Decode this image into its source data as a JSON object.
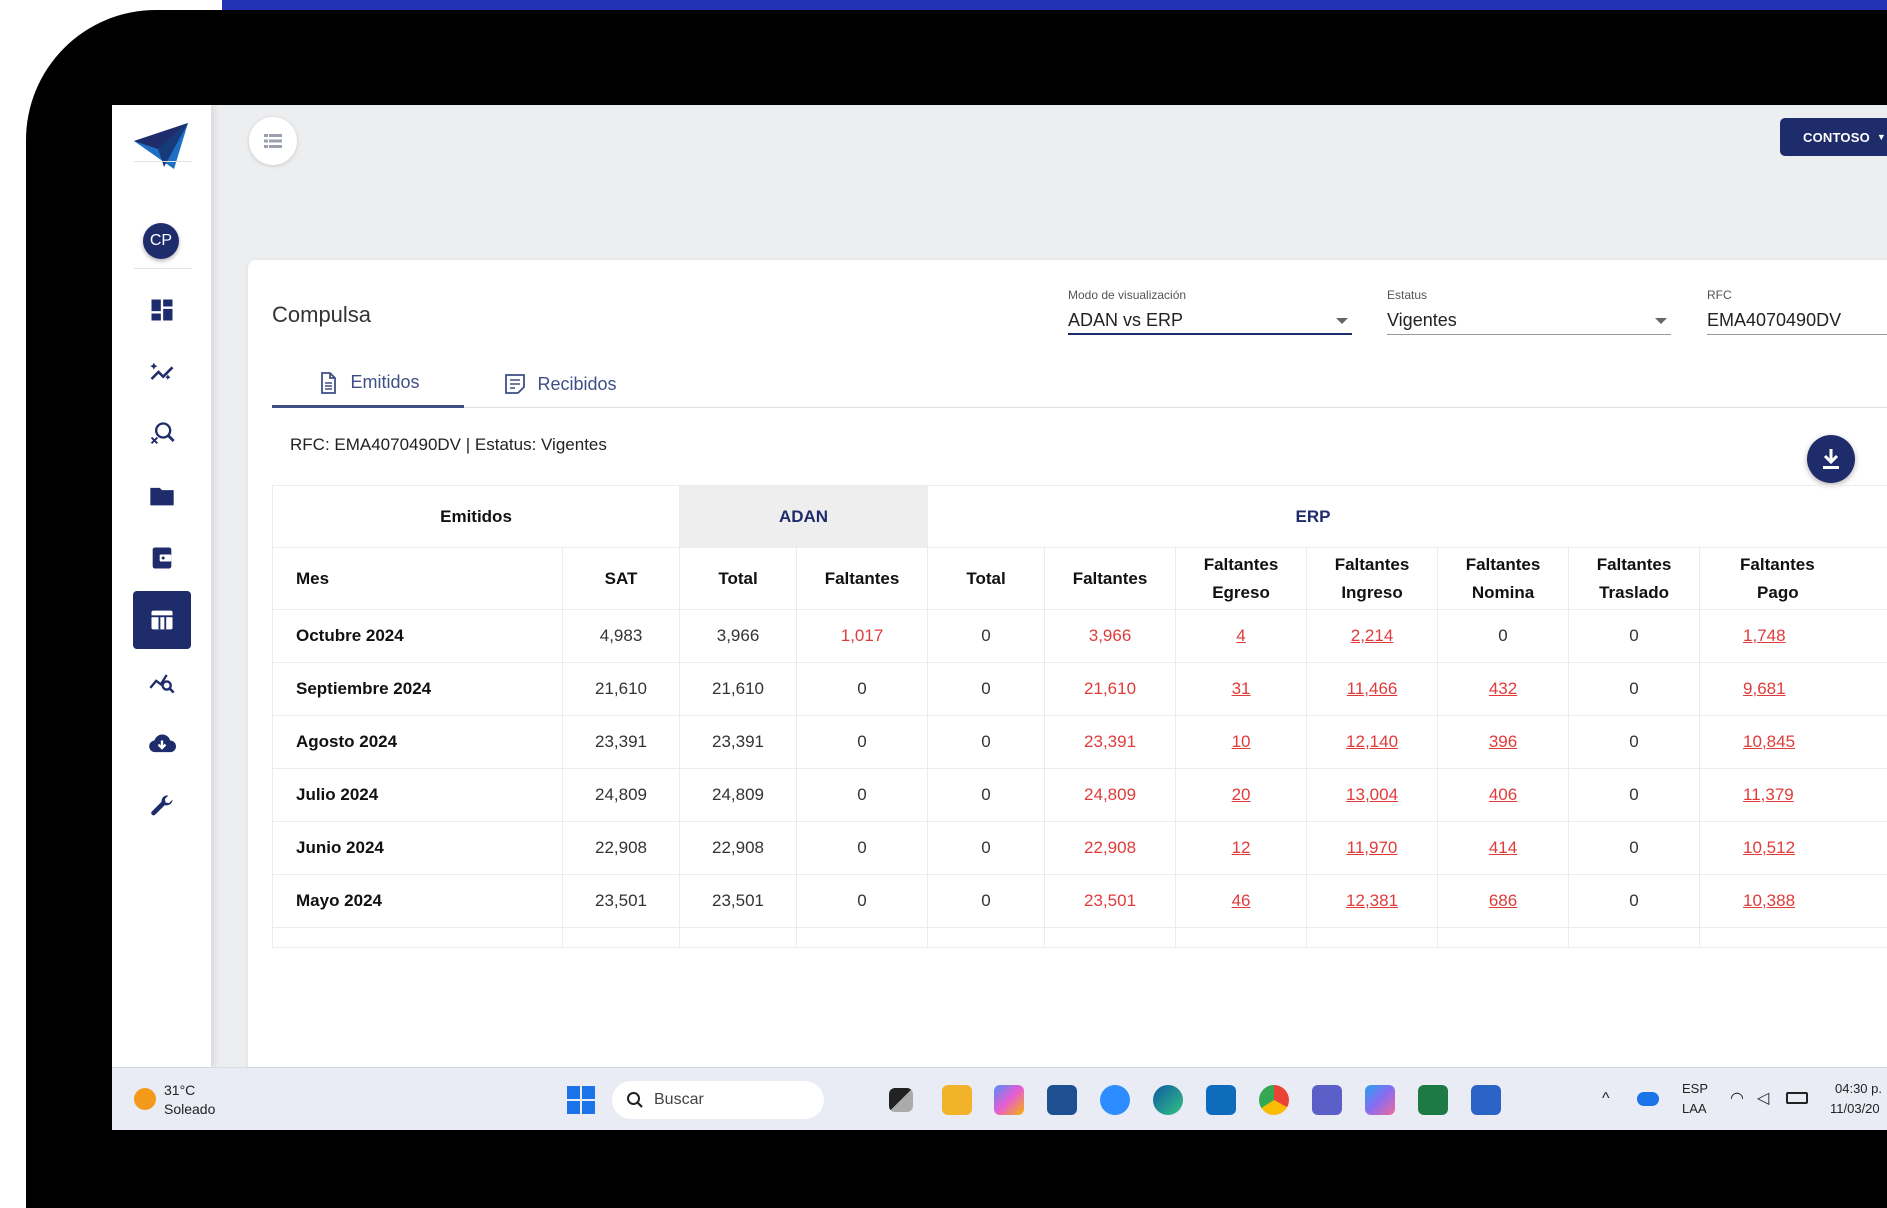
{
  "header": {
    "org_button": "CONTOSO"
  },
  "user": {
    "initials": "CP"
  },
  "card": {
    "title": "Compulsa",
    "selects": [
      {
        "label": "Modo de visualización",
        "value": "ADAN vs ERP"
      },
      {
        "label": "Estatus",
        "value": "Vigentes"
      },
      {
        "label": "RFC",
        "value": "EMA4070490DV"
      }
    ],
    "tabs": [
      {
        "label": "Emitidos"
      },
      {
        "label": "Recibidos"
      }
    ],
    "subtitle": "RFC: EMA4070490DV | Estatus: Vigentes"
  },
  "table": {
    "groups": {
      "emitidos": "Emitidos",
      "adan": "ADAN",
      "erp": "ERP"
    },
    "headers": {
      "mes": "Mes",
      "sat": "SAT",
      "adan_total": "Total",
      "adan_faltantes": "Faltantes",
      "erp_total": "Total",
      "erp_faltantes": "Faltantes",
      "fe_1": "Faltantes",
      "fe_2": "Egreso",
      "fi_1": "Faltantes",
      "fi_2": "Ingreso",
      "fn_1": "Faltantes",
      "fn_2": "Nomina",
      "ft_1": "Faltantes",
      "ft_2": "Traslado",
      "fp_1": "Faltantes",
      "fp_2": "Pago"
    },
    "rows": [
      {
        "mes": "Octubre 2024",
        "sat": "4,983",
        "adan_total": "3,966",
        "adan_faltantes": "1,017",
        "erp_total": "0",
        "erp_faltantes": "3,966",
        "egreso": "4",
        "ingreso": "2,214",
        "nomina": "0",
        "traslado": "0",
        "pago": "1,748"
      },
      {
        "mes": "Septiembre 2024",
        "sat": "21,610",
        "adan_total": "21,610",
        "adan_faltantes": "0",
        "erp_total": "0",
        "erp_faltantes": "21,610",
        "egreso": "31",
        "ingreso": "11,466",
        "nomina": "432",
        "traslado": "0",
        "pago": "9,681"
      },
      {
        "mes": "Agosto 2024",
        "sat": "23,391",
        "adan_total": "23,391",
        "adan_faltantes": "0",
        "erp_total": "0",
        "erp_faltantes": "23,391",
        "egreso": "10",
        "ingreso": "12,140",
        "nomina": "396",
        "traslado": "0",
        "pago": "10,845"
      },
      {
        "mes": "Julio 2024",
        "sat": "24,809",
        "adan_total": "24,809",
        "adan_faltantes": "0",
        "erp_total": "0",
        "erp_faltantes": "24,809",
        "egreso": "20",
        "ingreso": "13,004",
        "nomina": "406",
        "traslado": "0",
        "pago": "11,379"
      },
      {
        "mes": "Junio 2024",
        "sat": "22,908",
        "adan_total": "22,908",
        "adan_faltantes": "0",
        "erp_total": "0",
        "erp_faltantes": "22,908",
        "egreso": "12",
        "ingreso": "11,970",
        "nomina": "414",
        "traslado": "0",
        "pago": "10,512"
      },
      {
        "mes": "Mayo 2024",
        "sat": "23,501",
        "adan_total": "23,501",
        "adan_faltantes": "0",
        "erp_total": "0",
        "erp_faltantes": "23,501",
        "egreso": "46",
        "ingreso": "12,381",
        "nomina": "686",
        "traslado": "0",
        "pago": "10,388"
      }
    ]
  },
  "taskbar": {
    "weather_temp": "31°C",
    "weather_desc": "Soleado",
    "search_placeholder": "Buscar",
    "lang_1": "ESP",
    "lang_2": "LAA",
    "time": "04:30 p.",
    "date": "11/03/20"
  },
  "colors": {
    "primary": "#1f2c6b",
    "danger": "#e03b3b",
    "accent_strip": "#2233b8"
  }
}
